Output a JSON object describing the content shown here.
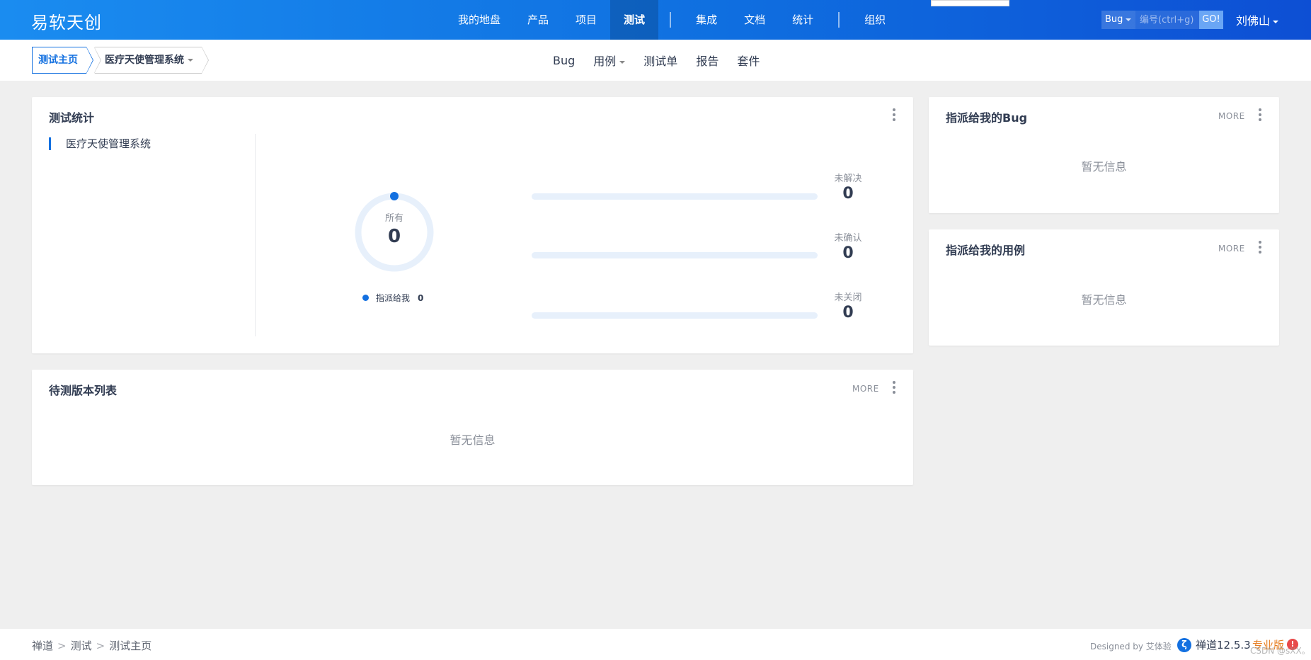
{
  "header": {
    "brand": "易软天创",
    "nav": [
      {
        "label": "我的地盘"
      },
      {
        "label": "产品"
      },
      {
        "label": "项目"
      },
      {
        "label": "测试",
        "active": true
      },
      {
        "label": "集成"
      },
      {
        "label": "文档"
      },
      {
        "label": "统计"
      },
      {
        "label": "组织"
      }
    ],
    "search": {
      "type": "Bug",
      "placeholder": "编号(ctrl+g)",
      "go": "GO!"
    },
    "user": "刘佛山"
  },
  "subnav": {
    "home": "测试主页",
    "product": "医疗天使管理系统",
    "items": [
      "Bug",
      "用例",
      "测试单",
      "报告",
      "套件"
    ]
  },
  "test_stats": {
    "title": "测试统计",
    "products": [
      "医疗天使管理系统"
    ],
    "total_label": "所有",
    "total": "0",
    "assigned_label": "指派给我",
    "assigned": "0",
    "unresolved_label": "未解决",
    "unresolved": "0",
    "unconfirmed_label": "未确认",
    "unconfirmed": "0",
    "unclosed_label": "未关闭",
    "unclosed": "0"
  },
  "builds": {
    "title": "待测版本列表",
    "more": "MORE",
    "empty": "暂无信息"
  },
  "my_bugs": {
    "title": "指派给我的Bug",
    "more": "MORE",
    "empty": "暂无信息"
  },
  "my_cases": {
    "title": "指派给我的用例",
    "more": "MORE",
    "empty": "暂无信息"
  },
  "footer": {
    "crumbs": [
      "禅道",
      "测试",
      "测试主页"
    ],
    "designed_by": "Designed by 艾体验",
    "version": "禅道12.5.3",
    "edition": "专业版",
    "watermark": "CSDN @sXX。"
  },
  "colors": {
    "accent": "#1370e0",
    "topbar_from": "#1a8cf0",
    "topbar_to": "#0d4fd4"
  }
}
